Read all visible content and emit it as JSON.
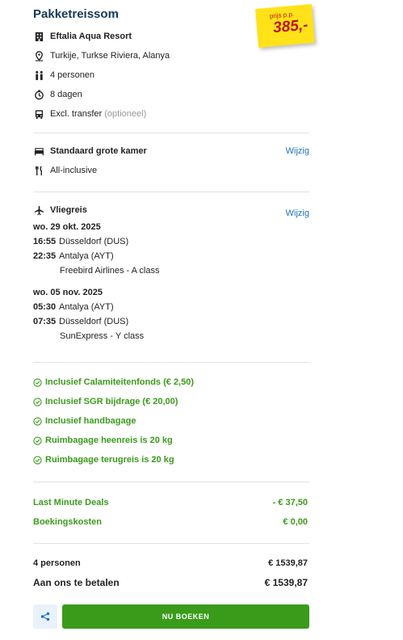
{
  "header": {
    "title": "Pakketreissom"
  },
  "price_sticker": {
    "label": "prijs p.p.",
    "price": "385,-"
  },
  "hotel": {
    "name": "Eftalia Aqua Resort",
    "location": "Turkije, Turkse Riviera, Alanya",
    "persons": "4 personen",
    "duration": "8 dagen",
    "transfer": "Excl. transfer",
    "transfer_note": "(optioneel)"
  },
  "room": {
    "name": "Standaard grote kamer",
    "board": "All-inclusive",
    "edit_label": "Wijzig"
  },
  "flight": {
    "title": "Vliegreis",
    "edit_label": "Wijzig",
    "outbound": {
      "date": "wo. 29 okt. 2025",
      "dep_time": "16:55",
      "dep_airport": "Düsseldorf (DUS)",
      "arr_time": "22:35",
      "arr_airport": "Antalya (AYT)",
      "carrier": "Freebird Airlines - A class"
    },
    "return": {
      "date": "wo. 05 nov. 2025",
      "dep_time": "05:30",
      "dep_airport": "Antalya (AYT)",
      "arr_time": "07:35",
      "arr_airport": "Düsseldorf (DUS)",
      "carrier": "SunExpress - Y class"
    }
  },
  "inclusions": [
    "Inclusief Calamiteitenfonds (€ 2,50)",
    "Inclusief SGR bijdrage (€ 20,00)",
    "Inclusief handbagage",
    "Ruimbagage heenreis is 20 kg",
    "Ruimbagage terugreis is 20 kg"
  ],
  "discounts": [
    {
      "label": "Last Minute Deals",
      "value": "- € 37,50"
    },
    {
      "label": "Boekingskosten",
      "value": "€ 0,00"
    }
  ],
  "summary": {
    "persons_label": "4 personen",
    "persons_total": "€ 1539,87",
    "pay_label": "Aan ons te betalen",
    "pay_total": "€ 1539,87"
  },
  "actions": {
    "share_icon": "share-icon",
    "book_label": "NU BOEKEN"
  },
  "colors": {
    "title": "#163a57",
    "accent_green": "#3a9b1b",
    "link_blue": "#1a73c8",
    "sticker_yellow": "#ffe218",
    "sticker_red": "#c0141b"
  }
}
